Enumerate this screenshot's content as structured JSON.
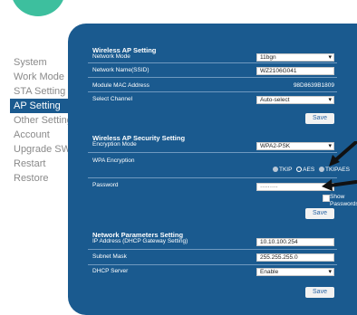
{
  "sidebar": {
    "items": [
      {
        "label": "System",
        "active": false
      },
      {
        "label": "Work Mode",
        "active": false
      },
      {
        "label": "STA Setting",
        "active": false
      },
      {
        "label": "AP Setting",
        "active": true
      },
      {
        "label": "Other Setting",
        "active": false
      },
      {
        "label": "Account",
        "active": false
      },
      {
        "label": "Upgrade SW",
        "active": false
      },
      {
        "label": "Restart",
        "active": false
      },
      {
        "label": "Restore",
        "active": false
      }
    ]
  },
  "ap": {
    "title": "Wireless AP Setting",
    "network_mode_label": "Network Mode",
    "network_mode_value": "11bgn",
    "ssid_label": "Network Name(SSID)",
    "ssid_value": "WZ2106G041",
    "mac_label": "Module MAC Address",
    "mac_value": "98D8639B1809",
    "channel_label": "Select Channel",
    "channel_value": "Auto-select",
    "save_label": "Save"
  },
  "security": {
    "title": "Wireless AP Security Setting",
    "encryption_mode_label": "Encryption Mode",
    "encryption_mode_value": "WPA2-PSK",
    "wpa_encryption_label": "WPA Encryption",
    "options": [
      "TKIP",
      "AES",
      "TKIPAES"
    ],
    "selected_option": "AES",
    "password_label": "Password",
    "password_value": "·········",
    "show_passwords_label": "Show Passwords",
    "save_label": "Save"
  },
  "network": {
    "title": "Network Parameters Setting",
    "ip_label": "IP Address (DHCP Gateway Setting)",
    "ip_value": "10.10.100.254",
    "subnet_label": "Subnet Mask",
    "subnet_value": "255.255.255.0",
    "dhcp_label": "DHCP Server",
    "dhcp_value": "Enable",
    "save_label": "Save"
  },
  "colors": {
    "panel": "#1a5a8f",
    "accent": "#3dbf9e",
    "button_text": "#2a65a5"
  },
  "icons": {
    "arrow_1": "arrow-icon",
    "arrow_2": "arrow-icon"
  }
}
